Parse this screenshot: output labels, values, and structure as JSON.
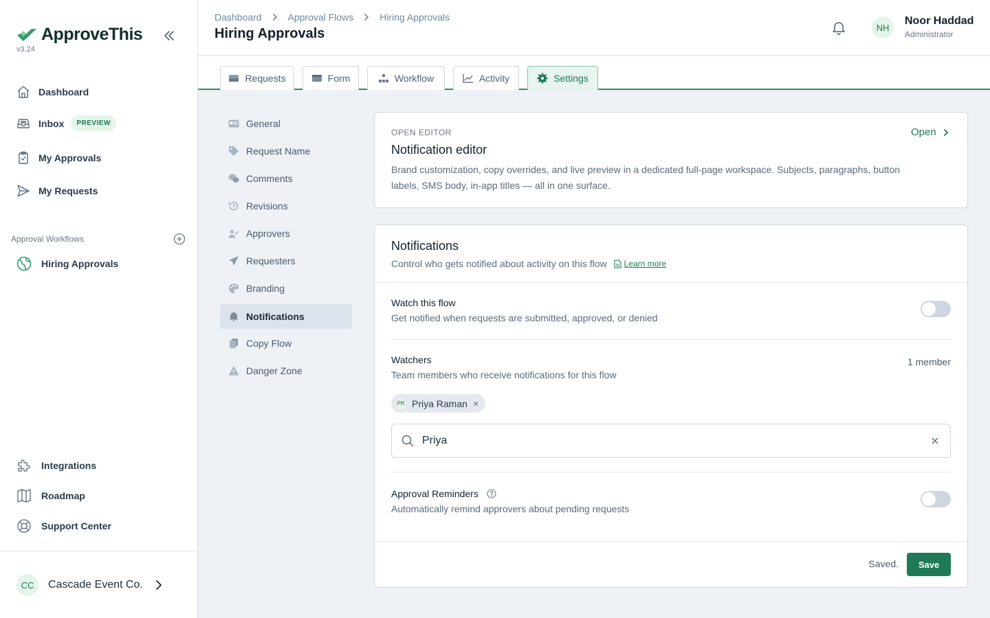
{
  "app": {
    "name": "ApproveThis",
    "version": "v3.24"
  },
  "colors": {
    "brand": "#1d7a52",
    "accent_bg": "#e4f5ea",
    "save_button": "#1e7a57"
  },
  "sidebar": {
    "nav": [
      {
        "label": "Dashboard",
        "icon": "home-icon"
      },
      {
        "label": "Inbox",
        "icon": "inbox-icon",
        "badge": "PREVIEW"
      },
      {
        "label": "My Approvals",
        "icon": "clipboard-check-icon"
      },
      {
        "label": "My Requests",
        "icon": "send-icon"
      }
    ],
    "section_label": "Approval Workflows",
    "workflows": [
      {
        "label": "Hiring Approvals",
        "icon": "workflow-globe-icon"
      }
    ],
    "bottom": [
      {
        "label": "Integrations",
        "icon": "puzzle-icon"
      },
      {
        "label": "Roadmap",
        "icon": "map-icon"
      },
      {
        "label": "Support Center",
        "icon": "lifebuoy-icon"
      }
    ],
    "org": {
      "initials": "CC",
      "name": "Cascade Event Co."
    }
  },
  "header": {
    "breadcrumb": [
      "Dashboard",
      "Approval Flows",
      "Hiring Approvals"
    ],
    "title": "Hiring Approvals",
    "user": {
      "initials": "NH",
      "name": "Noor Haddad",
      "role": "Administrator"
    }
  },
  "tabs": [
    {
      "label": "Requests",
      "icon": "inbox-tray-icon"
    },
    {
      "label": "Form",
      "icon": "form-icon"
    },
    {
      "label": "Workflow",
      "icon": "workflow-icon"
    },
    {
      "label": "Activity",
      "icon": "chart-line-icon"
    },
    {
      "label": "Settings",
      "icon": "gear-icon",
      "active": true
    }
  ],
  "settings_menu": [
    {
      "label": "General",
      "icon": "id-card-icon"
    },
    {
      "label": "Request Name",
      "icon": "tag-icon"
    },
    {
      "label": "Comments",
      "icon": "comments-icon"
    },
    {
      "label": "Revisions",
      "icon": "history-icon"
    },
    {
      "label": "Approvers",
      "icon": "user-check-icon"
    },
    {
      "label": "Requesters",
      "icon": "paper-plane-icon"
    },
    {
      "label": "Branding",
      "icon": "palette-icon"
    },
    {
      "label": "Notifications",
      "icon": "bell-icon",
      "active": true
    },
    {
      "label": "Copy Flow",
      "icon": "copy-icon"
    },
    {
      "label": "Danger Zone",
      "icon": "warning-icon"
    }
  ],
  "editor_card": {
    "eyebrow": "OPEN EDITOR",
    "title": "Notification editor",
    "description": "Brand customization, copy overrides, and live preview in a dedicated full-page workspace. Subjects, paragraphs, button labels, SMS body, in-app titles — all in one surface.",
    "open_label": "Open"
  },
  "notifications": {
    "title": "Notifications",
    "subtitle": "Control who gets notified about activity on this flow",
    "learn_more": "Learn more",
    "watch": {
      "title": "Watch this flow",
      "description": "Get notified when requests are submitted, approved, or denied",
      "enabled": false
    },
    "watchers": {
      "title": "Watchers",
      "description": "Team members who receive notifications for this flow",
      "count_label": "1 member",
      "members": [
        {
          "initials": "PR",
          "name": "Priya Raman"
        }
      ],
      "search_value": "Priya"
    },
    "reminders": {
      "title": "Approval Reminders",
      "description": "Automatically remind approvers about pending requests",
      "enabled": false
    },
    "status": "Saved.",
    "save_label": "Save"
  }
}
